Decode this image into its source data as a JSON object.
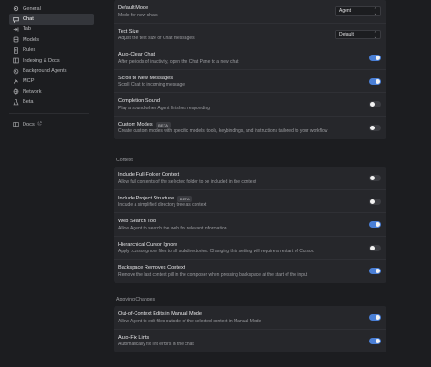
{
  "sidebar": {
    "items": [
      {
        "label": "General",
        "icon": "gear-icon"
      },
      {
        "label": "Chat",
        "icon": "chat-icon",
        "active": true
      },
      {
        "label": "Tab",
        "icon": "tab-icon"
      },
      {
        "label": "Models",
        "icon": "models-icon"
      },
      {
        "label": "Rules",
        "icon": "rules-icon"
      },
      {
        "label": "Indexing & Docs",
        "icon": "indexing-icon"
      },
      {
        "label": "Background Agents",
        "icon": "background-agents-icon"
      },
      {
        "label": "MCP",
        "icon": "mcp-icon"
      },
      {
        "label": "Network",
        "icon": "network-icon"
      },
      {
        "label": "Beta",
        "icon": "beta-icon"
      }
    ],
    "docs": {
      "label": "Docs",
      "icon": "docs-icon",
      "external_icon": "external-link-icon"
    }
  },
  "chat_settings": {
    "rows": [
      {
        "title": "Default Mode",
        "desc": "Mode for new chats",
        "control": "select",
        "value": "Agent"
      },
      {
        "title": "Text Size",
        "desc": "Adjust the text size of Chat messages",
        "control": "select",
        "value": "Default"
      },
      {
        "title": "Auto-Clear Chat",
        "desc": "After periods of inactivity, open the Chat Pane to a new chat",
        "control": "toggle",
        "on": true
      },
      {
        "title": "Scroll to New Messages",
        "desc": "Scroll Chat to incoming message",
        "control": "toggle",
        "on": true
      },
      {
        "title": "Completion Sound",
        "desc": "Play a sound when Agent finishes responding",
        "control": "toggle",
        "on": false
      },
      {
        "title": "Custom Modes",
        "badge": "BETA",
        "desc": "Create custom modes with specific models, tools, keybindings, and instructions tailored to your workflow",
        "control": "toggle",
        "on": false
      }
    ]
  },
  "context": {
    "title": "Context",
    "rows": [
      {
        "title": "Include Full-Folder Context",
        "desc": "Allow full contents of the selected folder to be included in the context",
        "control": "toggle",
        "on": false
      },
      {
        "title": "Include Project Structure",
        "badge": "BETA",
        "desc": "Include a simplified directory tree as context",
        "control": "toggle",
        "on": false
      },
      {
        "title": "Web Search Tool",
        "desc": "Allow Agent to search the web for relevant information",
        "control": "toggle",
        "on": true
      },
      {
        "title": "Hierarchical Cursor Ignore",
        "desc": "Apply .cursorignore files to all subdirectories. Changing this setting will require a restart of Cursor.",
        "control": "toggle",
        "on": false
      },
      {
        "title": "Backspace Removes Context",
        "desc": "Remove the last context pill in the composer when pressing backspace at the start of the input",
        "control": "toggle",
        "on": true
      }
    ]
  },
  "applying_changes": {
    "title": "Applying Changes",
    "rows": [
      {
        "title": "Out-of-Context Edits in Manual Mode",
        "desc": "Allow Agent to edit files outside of the selected context in Manual Mode",
        "control": "toggle",
        "on": true
      },
      {
        "title": "Auto-Fix Lints",
        "desc": "Automatically fix lint errors in the chat",
        "control": "toggle",
        "on": true
      }
    ]
  },
  "colors": {
    "accent": "#4a7fd6",
    "panel": "#26272b",
    "background": "#1c1d20"
  }
}
